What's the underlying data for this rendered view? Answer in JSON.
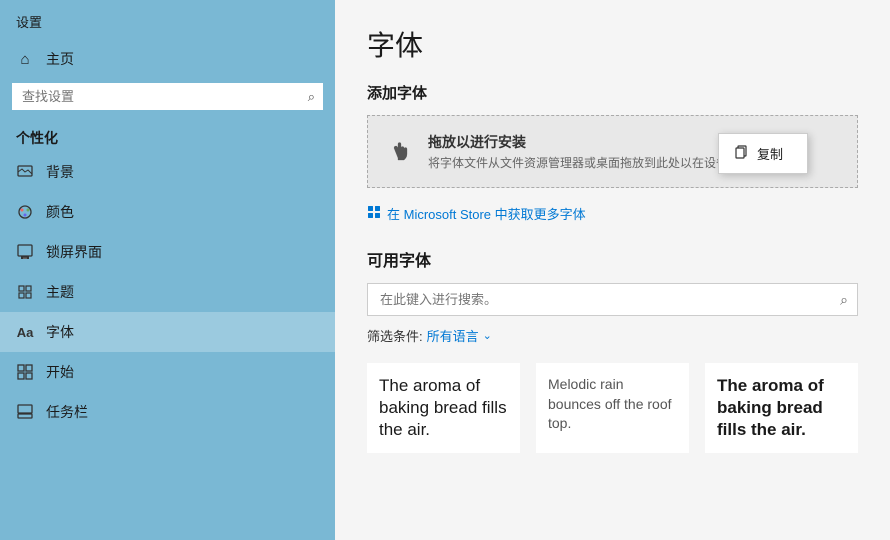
{
  "sidebar": {
    "title": "设置",
    "search_placeholder": "查找设置",
    "section_label": "个性化",
    "nav_items": [
      {
        "id": "home",
        "label": "主页",
        "icon": "⌂"
      },
      {
        "id": "background",
        "label": "背景",
        "icon": "🖼"
      },
      {
        "id": "color",
        "label": "颜色",
        "icon": "🎨"
      },
      {
        "id": "lockscreen",
        "label": "锁屏界面",
        "icon": "⬛"
      },
      {
        "id": "theme",
        "label": "主题",
        "icon": "✏"
      },
      {
        "id": "font",
        "label": "字体",
        "icon": "Aa",
        "active": true
      },
      {
        "id": "start",
        "label": "开始",
        "icon": "⊞"
      },
      {
        "id": "taskbar",
        "label": "任务栏",
        "icon": "▬"
      }
    ]
  },
  "main": {
    "page_title": "字体",
    "add_font_section": "添加字体",
    "drop_zone": {
      "main_text": "拖放以进行安装",
      "sub_text": "将字体文件从文件资源管理器或桌面拖放到此处以在设备上安装字体。"
    },
    "context_menu": {
      "item_label": "复制",
      "item_icon": "📋"
    },
    "store_link": "在 Microsoft Store 中获取更多字体",
    "available_fonts_title": "可用字体",
    "search_placeholder": "在此键入进行搜索。",
    "filter_label": "筛选条件:",
    "filter_value": "所有语言",
    "font_previews": [
      {
        "text": "The aroma of baking bread fills the air.",
        "style": "normal"
      },
      {
        "text": "Melodic rain bounces off the roof top.",
        "style": "light"
      },
      {
        "text": "The aroma of baking bread fills the air.",
        "style": "bold"
      }
    ]
  },
  "colors": {
    "sidebar_bg": "#7ab8d4",
    "accent": "#0078d4",
    "active_item_bg": "rgba(255,255,255,0.25)"
  }
}
